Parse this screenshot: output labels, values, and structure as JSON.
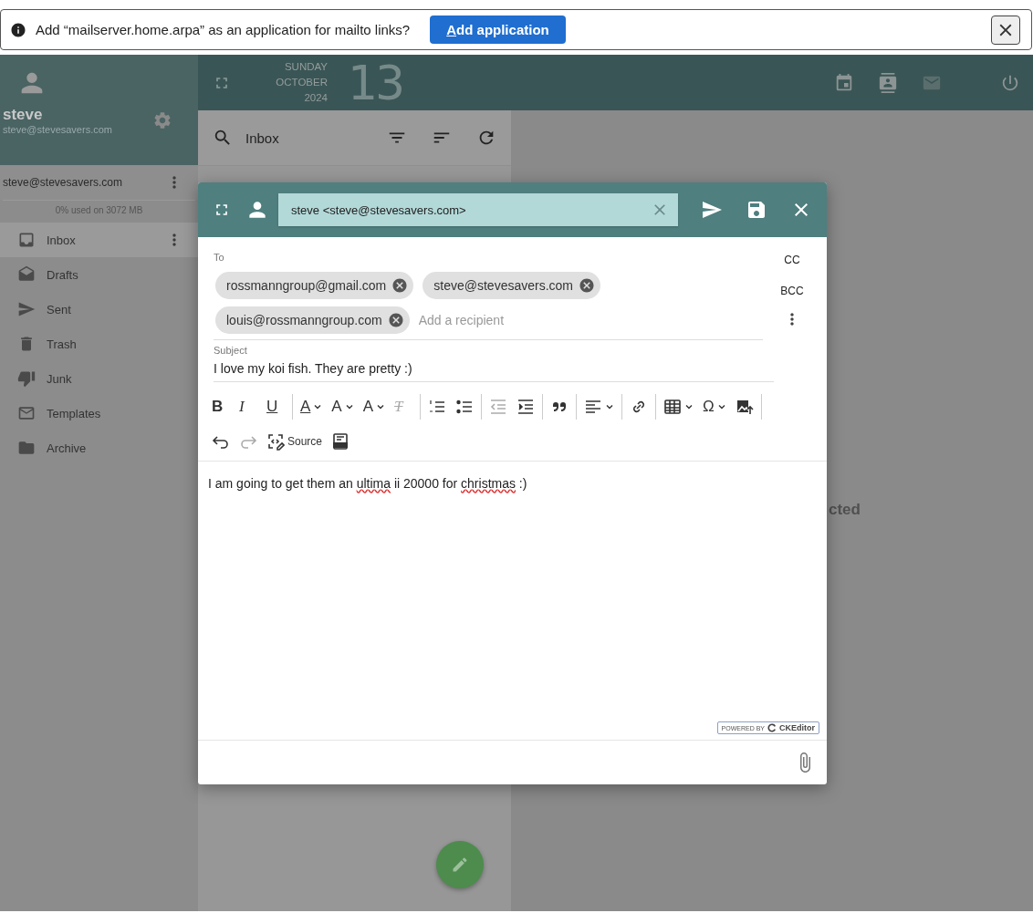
{
  "notification": {
    "message": "Add “mailserver.home.arpa” as an application for mailto links?",
    "button": "Add application"
  },
  "sidebar": {
    "user": {
      "name": "steve",
      "email": "steve@stevesavers.com"
    },
    "account": {
      "email": "steve@stevesavers.com",
      "quota": "0% used on 3072 MB"
    },
    "folders": [
      {
        "label": "Inbox",
        "selected": true
      },
      {
        "label": "Drafts",
        "selected": false
      },
      {
        "label": "Sent",
        "selected": false
      },
      {
        "label": "Trash",
        "selected": false
      },
      {
        "label": "Junk",
        "selected": false
      },
      {
        "label": "Templates",
        "selected": false
      },
      {
        "label": "Archive",
        "selected": false
      }
    ]
  },
  "topbar": {
    "weekday": "SUNDAY",
    "month": "OCTOBER",
    "year": "2024",
    "day": "13"
  },
  "list": {
    "folder": "Inbox"
  },
  "reading_pane": {
    "message": "cted"
  },
  "composer": {
    "identity": "steve <steve@stevesavers.com>",
    "to_label": "To",
    "cc": "CC",
    "bcc": "BCC",
    "recipients": [
      "rossmanngroup@gmail.com",
      "steve@stevesavers.com",
      "louis@rossmanngroup.com"
    ],
    "recipient_placeholder": "Add a recipient",
    "subject_label": "Subject",
    "subject": "I love my koi fish. They are pretty :)",
    "toolbar": [
      {
        "kind": "glyph",
        "text": "B",
        "disabled": false,
        "dropdown": false
      },
      {
        "kind": "glyph",
        "text": "I",
        "disabled": false,
        "dropdown": false
      },
      {
        "kind": "glyph",
        "text": "U",
        "disabled": false,
        "dropdown": false
      },
      {
        "kind": "separator"
      },
      {
        "kind": "glyph",
        "text": "A",
        "disabled": false,
        "dropdown": true
      },
      {
        "kind": "glyph",
        "text": "A",
        "disabled": false,
        "dropdown": true
      },
      {
        "kind": "glyph",
        "text": "A",
        "disabled": false,
        "dropdown": true
      },
      {
        "kind": "glyph",
        "text": "T",
        "disabled": true,
        "dropdown": false
      },
      {
        "kind": "separator"
      },
      {
        "kind": "icon",
        "disabled": false,
        "dropdown": false
      },
      {
        "kind": "icon",
        "disabled": false,
        "dropdown": false
      },
      {
        "kind": "separator"
      },
      {
        "kind": "icon",
        "disabled": true,
        "dropdown": false
      },
      {
        "kind": "icon",
        "disabled": false,
        "dropdown": false
      },
      {
        "kind": "separator"
      },
      {
        "kind": "icon",
        "disabled": false,
        "dropdown": false
      },
      {
        "kind": "separator"
      },
      {
        "kind": "icon",
        "disabled": false,
        "dropdown": true
      },
      {
        "kind": "separator"
      },
      {
        "kind": "icon",
        "disabled": false,
        "dropdown": false
      },
      {
        "kind": "separator"
      },
      {
        "kind": "icon",
        "disabled": false,
        "dropdown": true
      },
      {
        "kind": "glyph",
        "text": "Ω",
        "disabled": false,
        "dropdown": true
      },
      {
        "kind": "icon",
        "disabled": false,
        "dropdown": false
      },
      {
        "kind": "separator"
      },
      {
        "kind": "break"
      },
      {
        "kind": "icon",
        "disabled": false,
        "dropdown": false
      },
      {
        "kind": "icon",
        "disabled": true,
        "dropdown": false
      },
      {
        "kind": "labeled",
        "text": "Source",
        "disabled": false,
        "dropdown": false
      },
      {
        "kind": "icon",
        "disabled": false,
        "dropdown": false
      }
    ],
    "body": [
      {
        "text": "I am going to get them an ",
        "misspelled": false
      },
      {
        "text": "ultima",
        "misspelled": true
      },
      {
        "text": " ii 20000 for ",
        "misspelled": false
      },
      {
        "text": "christmas",
        "misspelled": true
      },
      {
        "text": " :)",
        "misspelled": false
      }
    ],
    "badge": {
      "prefix": "POWERED BY",
      "brand": "CKEditor"
    }
  }
}
